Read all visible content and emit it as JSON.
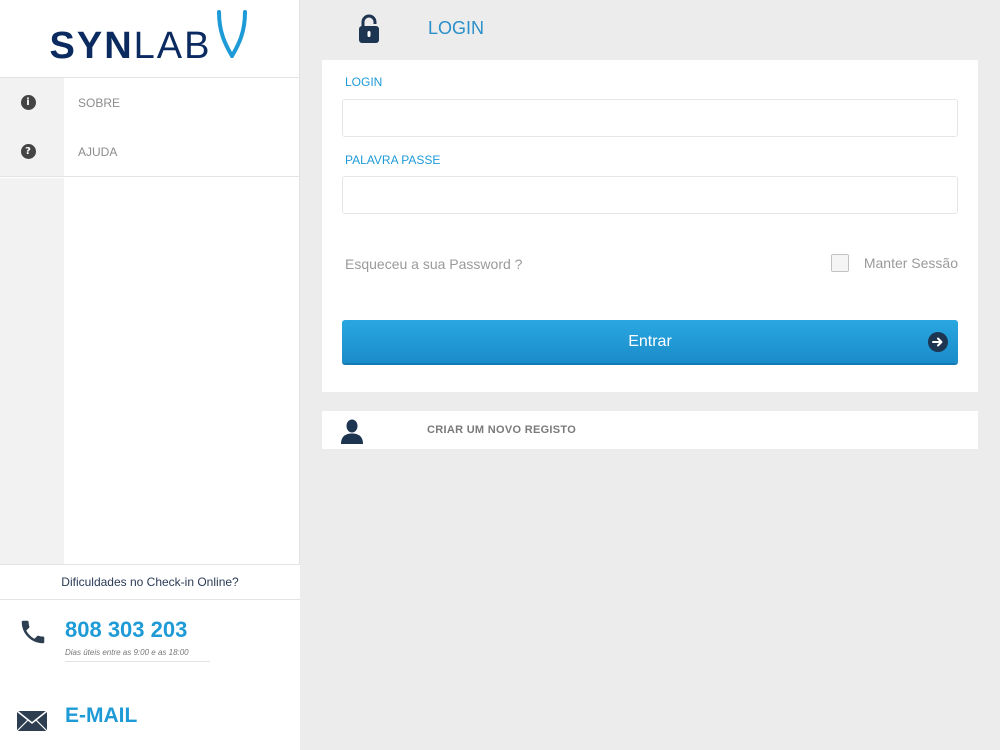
{
  "brand": {
    "name_bold": "SYN",
    "name_light": "LAB",
    "color": "#0a2a60"
  },
  "sidebar": {
    "items": [
      {
        "icon": "info-icon",
        "glyph": "i",
        "label": "SOBRE"
      },
      {
        "icon": "help-icon",
        "glyph": "?",
        "label": "AJUDA"
      }
    ]
  },
  "help": {
    "title": "Dificuldades no Check-in Online?",
    "phone": "808 303 203",
    "phone_hours": "Dias úteis entre as 9:00 e as 18:00",
    "email_label": "E-MAIL"
  },
  "header": {
    "title": "LOGIN",
    "icon": "lock-icon"
  },
  "form": {
    "login_label": "LOGIN",
    "login_value": "",
    "password_label": "PALAVRA PASSE",
    "password_value": "",
    "forgot_label": "Esqueceu a sua Password ?",
    "keep_session_label": "Manter Sessão",
    "keep_session_checked": false,
    "submit_label": "Entrar"
  },
  "register": {
    "label": "CRIAR UM NOVO REGISTO",
    "icon": "user-icon"
  },
  "colors": {
    "accent": "#1e9bd7",
    "button": "#1a8cc9",
    "background": "#ececed"
  }
}
